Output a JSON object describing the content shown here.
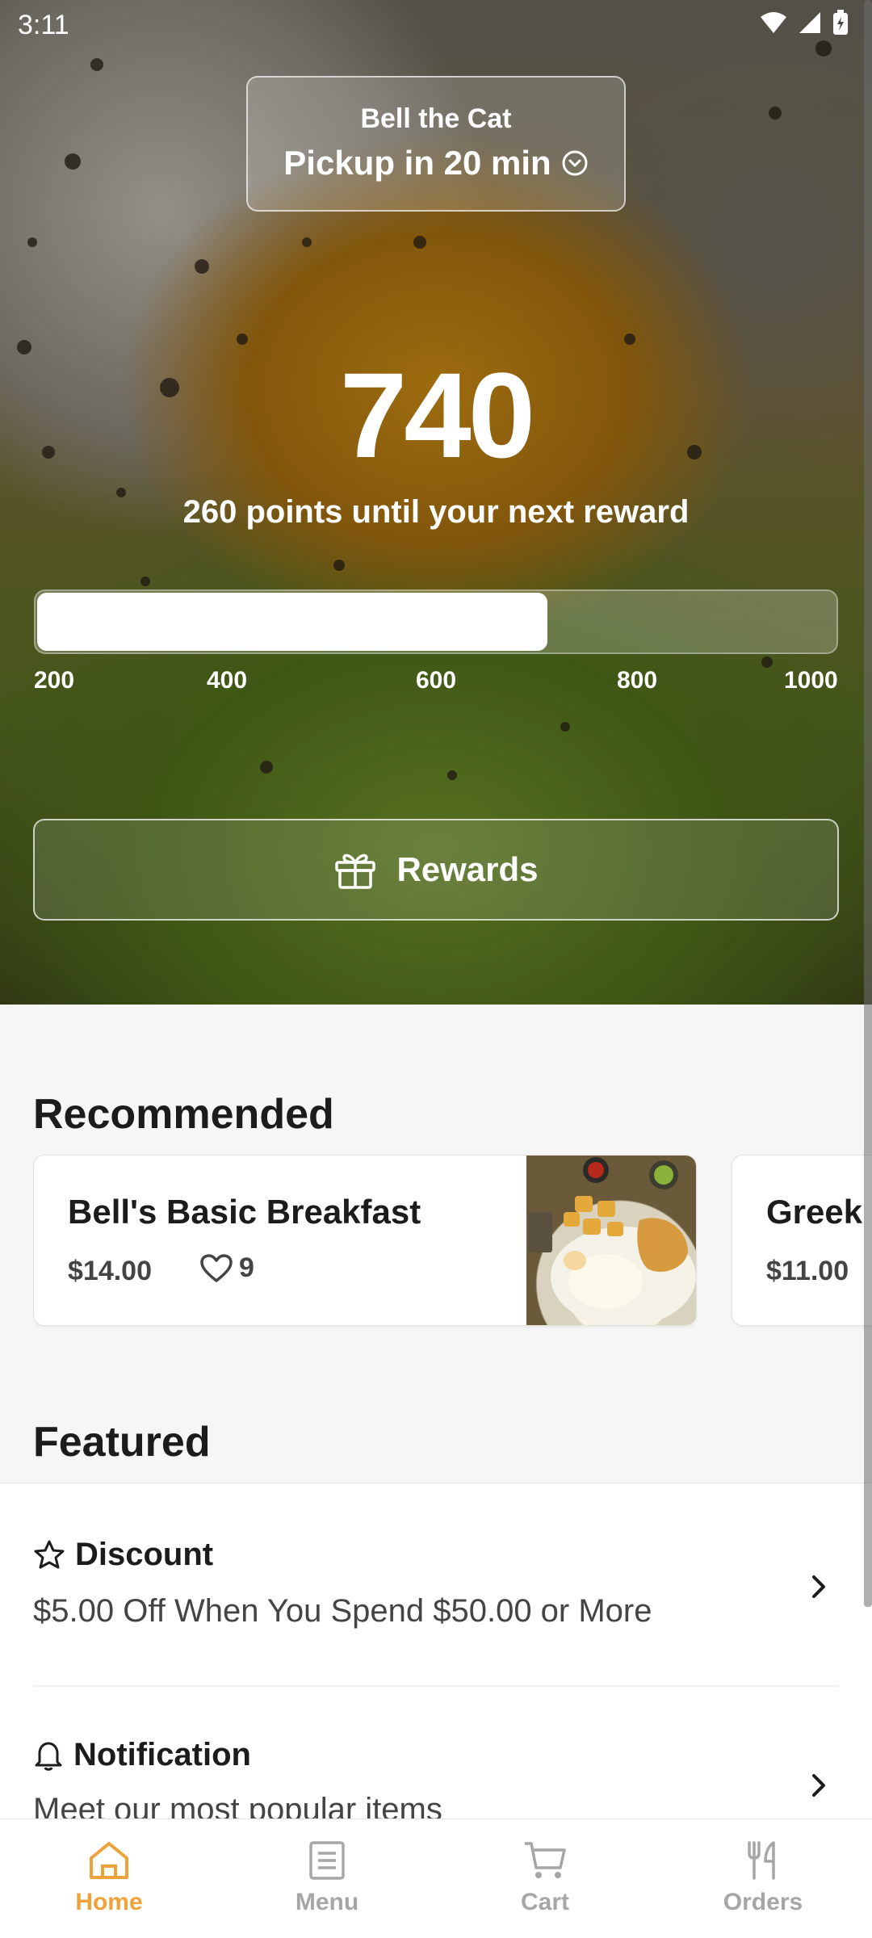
{
  "status_bar": {
    "time": "3:11"
  },
  "location": {
    "name": "Bell the Cat",
    "pickup": "Pickup in 20 min"
  },
  "points": {
    "value": "740",
    "subtitle": "260 points until your next reward",
    "progress_fraction": 0.64,
    "ticks": [
      "200",
      "400",
      "600",
      "800",
      "1000"
    ]
  },
  "rewards_button": {
    "label": "Rewards"
  },
  "recommended": {
    "title": "Recommended",
    "items": [
      {
        "name": "Bell's Basic Breakfast",
        "price": "$14.00",
        "likes": "9"
      },
      {
        "name": "Greek",
        "price": "$11.00"
      }
    ]
  },
  "featured": {
    "title": "Featured",
    "items": [
      {
        "title": "Discount",
        "description": "$5.00 Off When You Spend $50.00 or More",
        "icon": "star-icon"
      },
      {
        "title": "Notification",
        "description": "Meet our most popular items",
        "icon": "bell-icon"
      }
    ]
  },
  "bottom_nav": {
    "items": [
      {
        "label": "Home",
        "icon": "home-icon",
        "active": true
      },
      {
        "label": "Menu",
        "icon": "menu-icon",
        "active": false
      },
      {
        "label": "Cart",
        "icon": "cart-icon",
        "active": false
      },
      {
        "label": "Orders",
        "icon": "utensils-icon",
        "active": false
      }
    ]
  },
  "colors": {
    "accent": "#f0a23a",
    "inactive_nav": "#a6a6a6"
  }
}
